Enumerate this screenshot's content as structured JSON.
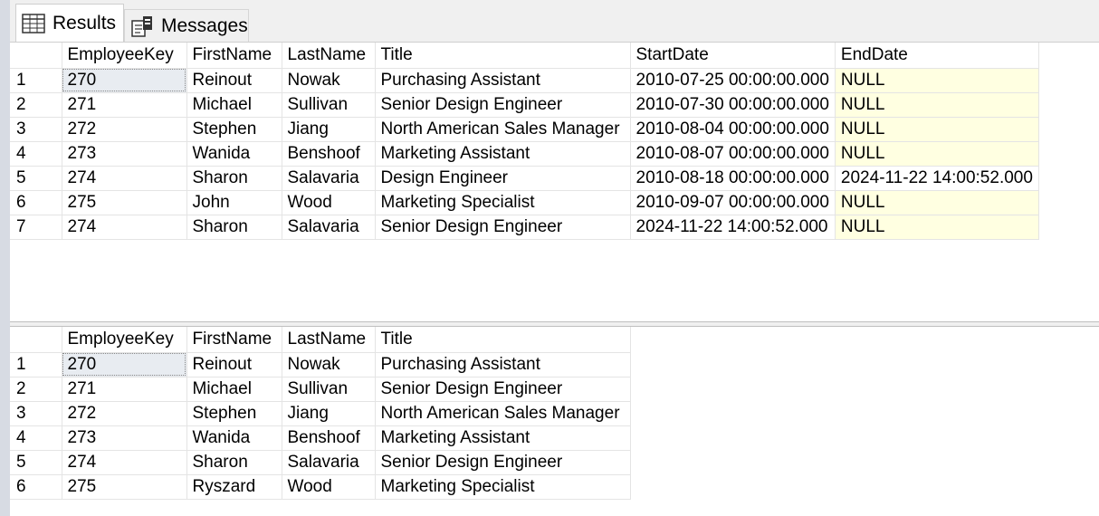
{
  "tabs": [
    {
      "label": "Results",
      "icon": "grid-icon",
      "active": true
    },
    {
      "label": "Messages",
      "icon": "messages-icon",
      "active": false
    }
  ],
  "colors": {
    "null_bg": "#ffffe1",
    "selected_bg": "#e8ecf1",
    "grid_line": "#e4e4e4"
  },
  "result1": {
    "columns": [
      "EmployeeKey",
      "FirstName",
      "LastName",
      "Title",
      "StartDate",
      "EndDate"
    ],
    "rows": [
      [
        "1",
        "270",
        "Reinout",
        "Nowak",
        "Purchasing Assistant",
        "2010-07-25 00:00:00.000",
        "NULL"
      ],
      [
        "2",
        "271",
        "Michael",
        "Sullivan",
        "Senior Design Engineer",
        "2010-07-30 00:00:00.000",
        "NULL"
      ],
      [
        "3",
        "272",
        "Stephen",
        "Jiang",
        "North American Sales Manager",
        "2010-08-04 00:00:00.000",
        "NULL"
      ],
      [
        "4",
        "273",
        "Wanida",
        "Benshoof",
        "Marketing Assistant",
        "2010-08-07 00:00:00.000",
        "NULL"
      ],
      [
        "5",
        "274",
        "Sharon",
        "Salavaria",
        "Design Engineer",
        "2010-08-18 00:00:00.000",
        "2024-11-22 14:00:52.000"
      ],
      [
        "6",
        "275",
        "John",
        "Wood",
        "Marketing Specialist",
        "2010-09-07 00:00:00.000",
        "NULL"
      ],
      [
        "7",
        "274",
        "Sharon",
        "Salavaria",
        "Senior Design Engineer",
        "2024-11-22 14:00:52.000",
        "NULL"
      ]
    ]
  },
  "result2": {
    "columns": [
      "EmployeeKey",
      "FirstName",
      "LastName",
      "Title"
    ],
    "rows": [
      [
        "1",
        "270",
        "Reinout",
        "Nowak",
        "Purchasing Assistant"
      ],
      [
        "2",
        "271",
        "Michael",
        "Sullivan",
        "Senior Design Engineer"
      ],
      [
        "3",
        "272",
        "Stephen",
        "Jiang",
        "North American Sales Manager"
      ],
      [
        "4",
        "273",
        "Wanida",
        "Benshoof",
        "Marketing Assistant"
      ],
      [
        "5",
        "274",
        "Sharon",
        "Salavaria",
        "Senior Design Engineer"
      ],
      [
        "6",
        "275",
        "Ryszard",
        "Wood",
        "Marketing Specialist"
      ]
    ]
  }
}
